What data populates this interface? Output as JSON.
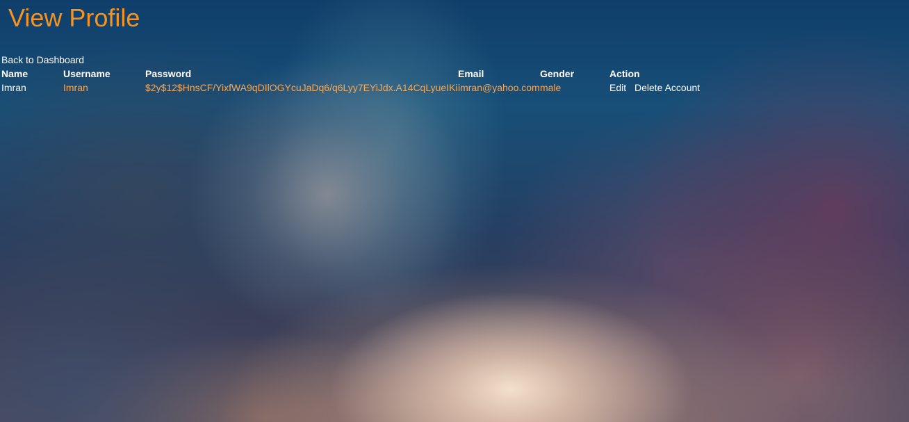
{
  "page": {
    "title": "View Profile",
    "back_link": "Back to Dashboard"
  },
  "table": {
    "headers": {
      "name": "Name",
      "username": "Username",
      "password": "Password",
      "email": "Email",
      "gender": "Gender",
      "action": "Action"
    },
    "rows": [
      {
        "name": "Imran",
        "username": "Imran",
        "password": "$2y$12$HnsCF/YixfWA9qDIlOGYcuJaDq6/q6Lyy7EYiJdx.A14CqLyueIKi",
        "email": "imran@yahoo.com",
        "gender": "male",
        "edit_label": "Edit",
        "delete_label": "Delete Account"
      }
    ]
  },
  "colors": {
    "title": "#f7931e",
    "data_accent": "#f7a857",
    "text": "#ffffff"
  }
}
